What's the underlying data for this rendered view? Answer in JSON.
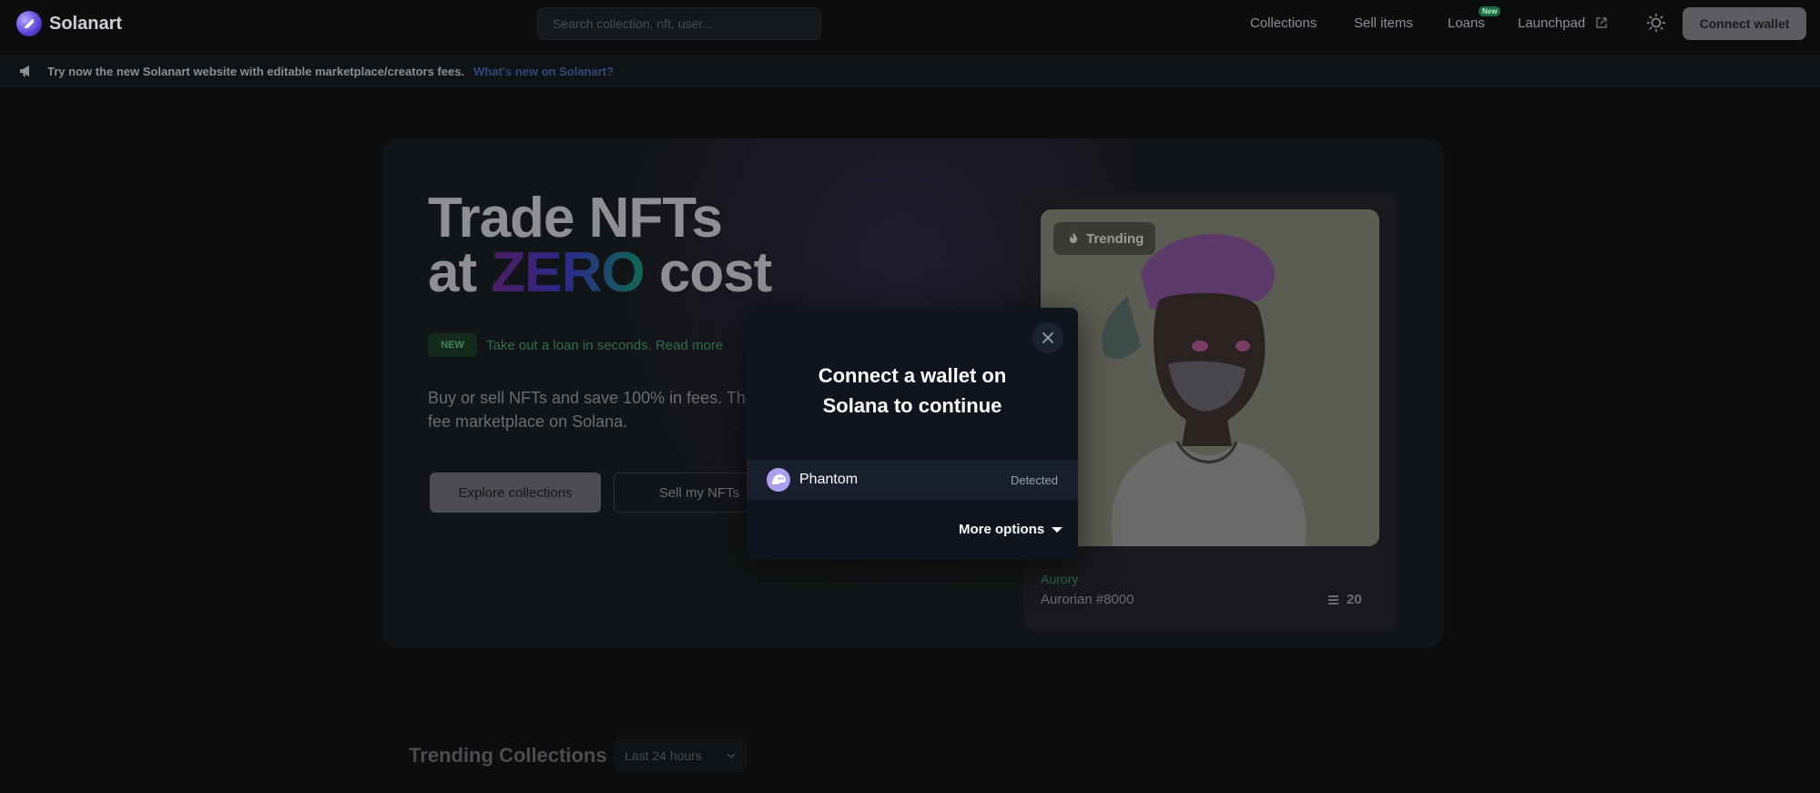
{
  "header": {
    "brand": "Solanart",
    "search_placeholder": "Search collection, nft, user...",
    "nav": {
      "collections": "Collections",
      "sell_items": "Sell items",
      "loans": "Loans",
      "loans_badge": "New",
      "launchpad": "Launchpad"
    },
    "connect_wallet": "Connect wallet"
  },
  "announcement": {
    "text": "Try now the new Solanart website with editable marketplace/creators fees.",
    "link": "What's new on Solanart?"
  },
  "hero": {
    "title_line1": "Trade NFTs",
    "title_at": "at",
    "title_zero": "ZERO",
    "title_cost": "cost",
    "new_badge": "NEW",
    "loan_text": "Take out a loan in seconds. Read more",
    "description": "Buy or sell NFTs and save 100% in fees. The fee marketplace on Solana.",
    "explore_button": "Explore collections",
    "sell_button": "Sell my NFTs"
  },
  "nft_card": {
    "trending_label": "Trending",
    "collection": "Aurory",
    "name": "Aurorian #8000",
    "price": "20"
  },
  "trending_section": {
    "title": "Trending Collections",
    "period": "Last 24 hours"
  },
  "modal": {
    "title_line1": "Connect a wallet on",
    "title_line2": "Solana to continue",
    "wallet": {
      "name": "Phantom",
      "status": "Detected"
    },
    "more_options": "More options"
  }
}
